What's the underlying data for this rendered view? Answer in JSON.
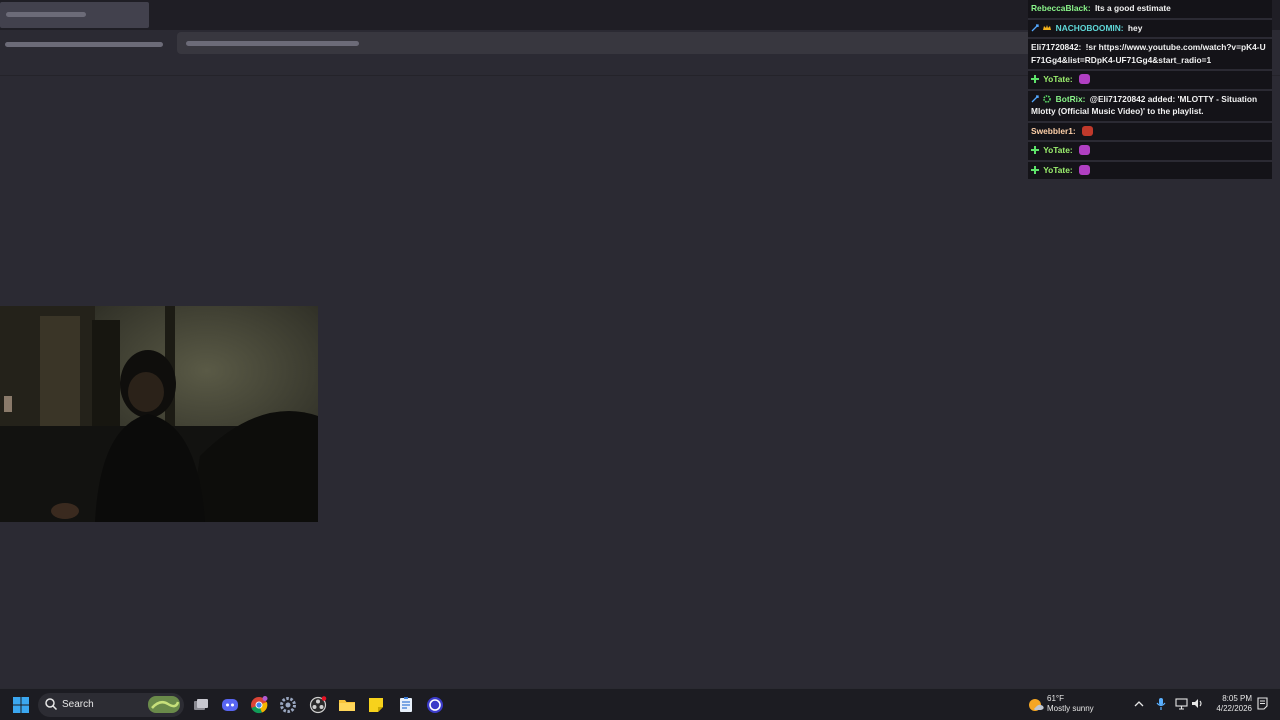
{
  "chat": {
    "messages": [
      {
        "user": "RebeccaBlack",
        "sep": ":",
        "text": "Its a good estimate",
        "color": "#8af58a",
        "badges": []
      },
      {
        "user": "NACHOBOOMIN",
        "sep": ":",
        "text": "hey",
        "color": "#5fd8d8",
        "badges": [
          "sword-badge-icon",
          "crown-badge-icon"
        ]
      },
      {
        "user": "Eli71720842",
        "sep": ":",
        "text": "!sr https://www.youtube.com/watch?v=pK4-UF71Gg4&list=RDpK4-UF71Gg4&start_radio=1",
        "color": "#f2f2f2",
        "badges": []
      },
      {
        "user": "YoTate",
        "sep": ":",
        "text": "",
        "color": "#9cf06e",
        "badges": [
          "plus-badge-icon"
        ],
        "emote": "purple-emote-icon"
      },
      {
        "user": "BotRix",
        "sep": ":",
        "text": "@Eli71720842 added: 'MLOTTY - Situation Mlotty (Official Music Video)' to the playlist.",
        "color": "#8af58a",
        "badges": [
          "sword-badge-icon",
          "gear-badge-icon"
        ]
      },
      {
        "user": "Swebbler1",
        "sep": ":",
        "text": "",
        "color": "#ffd0a8",
        "badges": [],
        "emote": "red-emote-icon"
      },
      {
        "user": "YoTate",
        "sep": ":",
        "text": "",
        "color": "#9cf06e",
        "badges": [
          "plus-badge-icon"
        ],
        "emote": "purple-emote-icon"
      },
      {
        "user": "YoTate",
        "sep": ":",
        "text": "",
        "color": "#9cf06e",
        "badges": [
          "plus-badge-icon"
        ],
        "emote": "purple-emote-icon"
      }
    ]
  },
  "taskbar": {
    "search_label": "Search",
    "weather_temp": "61°F",
    "weather_desc": "Mostly sunny",
    "time": "8:05 PM",
    "date": "4/22/2026",
    "apps": [
      "windows-start-icon",
      "task-view-icon",
      "discord-icon",
      "chrome-icon",
      "settings-icon",
      "obs-icon",
      "file-explorer-icon",
      "sticky-notes-icon",
      "notepad-icon",
      "cortana-icon"
    ]
  }
}
